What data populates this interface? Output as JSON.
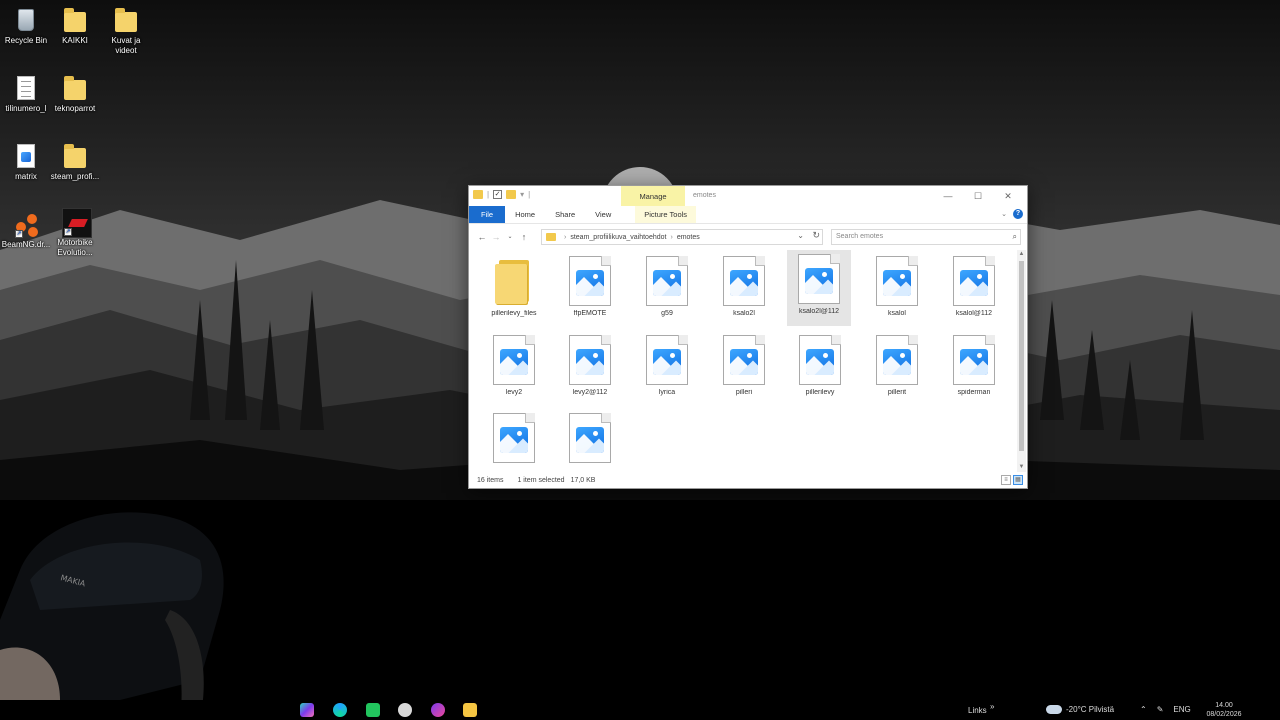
{
  "desktop": {
    "icons": [
      {
        "label": "Recycle Bin",
        "icon": "recycle-bin-icon"
      },
      {
        "label": "KAIKKI",
        "icon": "folder-icon"
      },
      {
        "label": "Kuvat ja videot",
        "icon": "folder-icon"
      },
      {
        "label": "tilinumero_l",
        "icon": "text-document-icon"
      },
      {
        "label": "teknoparrot",
        "icon": "folder-icon"
      },
      {
        "label": "matrix",
        "icon": "image-file-icon"
      },
      {
        "label": "steam_profi...",
        "icon": "folder-icon"
      },
      {
        "label": "BeamNG.dr...",
        "icon": "beamng-icon"
      },
      {
        "label": "Motorbike Evolutio...",
        "icon": "motorbike-game-icon"
      }
    ]
  },
  "explorer": {
    "title": "emotes",
    "manage_tab": "Manage",
    "ribbon_tabs": [
      "File",
      "Home",
      "Share",
      "View"
    ],
    "picture_tools_tab": "Picture Tools",
    "breadcrumb": [
      "steam_profiilikuva_vaihtoehdot",
      "emotes"
    ],
    "search_placeholder": "Search emotes",
    "items": [
      {
        "name": "pillerilevy_files",
        "type": "folder"
      },
      {
        "name": "ffpEMOTE",
        "type": "image"
      },
      {
        "name": "g59",
        "type": "image"
      },
      {
        "name": "ksalo2l",
        "type": "image"
      },
      {
        "name": "ksalo2l@112",
        "type": "image",
        "selected": true
      },
      {
        "name": "ksalol",
        "type": "image"
      },
      {
        "name": "ksalol@112",
        "type": "image"
      },
      {
        "name": "levy2",
        "type": "image"
      },
      {
        "name": "levy2@112",
        "type": "image"
      },
      {
        "name": "lyrica",
        "type": "image"
      },
      {
        "name": "pilleri",
        "type": "image"
      },
      {
        "name": "pillerilevy",
        "type": "image"
      },
      {
        "name": "pillerit",
        "type": "image"
      },
      {
        "name": "spiderman",
        "type": "image"
      },
      {
        "name": "",
        "type": "image"
      },
      {
        "name": "",
        "type": "image"
      }
    ],
    "status": {
      "count": "16 items",
      "selection": "1 item selected",
      "size": "17,0 KB"
    }
  },
  "taskbar": {
    "links": "Links",
    "weather": "-20°C Pilvistä",
    "language": "ENG",
    "time": "14.00",
    "date": "08/02/2026",
    "accent": "#1a6cce"
  }
}
